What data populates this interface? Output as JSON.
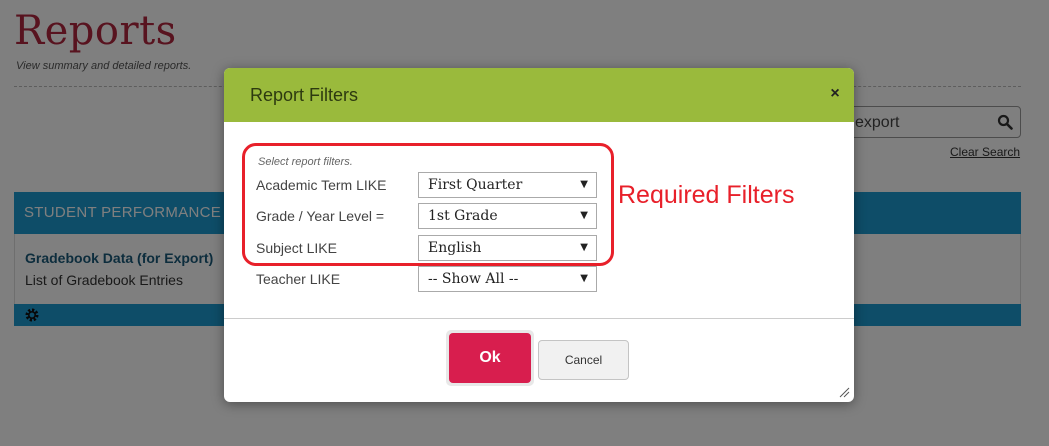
{
  "page": {
    "title": "Reports",
    "subtitle": "View summary and detailed reports.",
    "search_value": "export",
    "clear_search": "Clear Search",
    "section_title": "Student Performance",
    "report_name": "Gradebook Data (for Export)",
    "report_desc": "List of Gradebook Entries"
  },
  "modal": {
    "title": "Report Filters",
    "close_label": "×",
    "hint": "Select report filters.",
    "filters": [
      {
        "label": "Academic Term LIKE",
        "value": "First Quarter"
      },
      {
        "label": "Grade / Year Level =",
        "value": "1st Grade"
      },
      {
        "label": "Subject LIKE",
        "value": "English"
      },
      {
        "label": "Teacher LIKE",
        "value": "-- Show All --"
      }
    ],
    "ok_label": "Ok",
    "cancel_label": "Cancel"
  },
  "annotation": {
    "text": "Required Filters"
  },
  "colors": {
    "header_green": "#9aba3c",
    "section_blue": "#1c9bd1",
    "ok_red": "#d81e4e",
    "title_red": "#b0263e",
    "annotation_red": "#e8202a"
  }
}
